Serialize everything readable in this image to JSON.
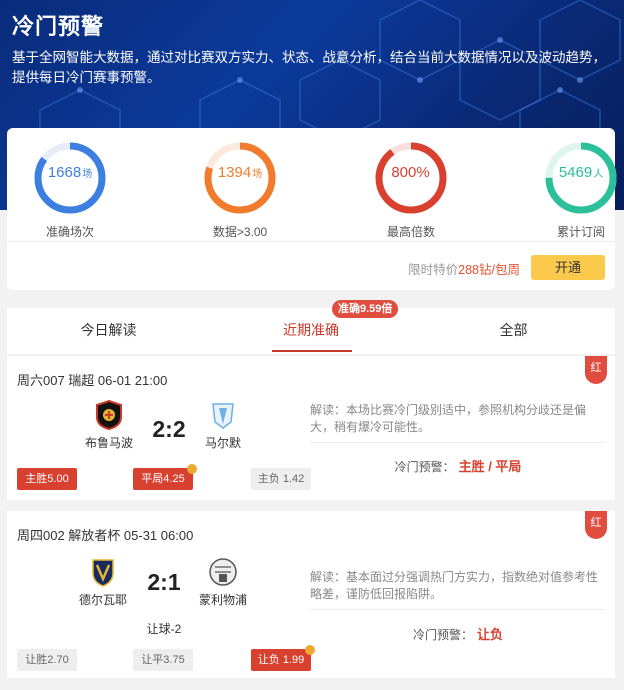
{
  "hero": {
    "title": "冷门预警",
    "description": "基于全网智能大数据，通过对比赛双方实力、状态、战意分析，结合当前大数据情况以及波动趋势，提供每日冷门赛事预警。"
  },
  "stats": [
    {
      "value": "1668",
      "unit": "场",
      "label": "准确场次",
      "color": "#3d7fe0",
      "fill": 0.85
    },
    {
      "value": "1394",
      "unit": "场",
      "label": "数据>3.00",
      "color": "#f07b2d",
      "fill": 0.8
    },
    {
      "value": "800%",
      "unit": "",
      "label": "最高倍数",
      "color": "#d8412f",
      "fill": 0.9
    },
    {
      "value": "5469",
      "unit": "人",
      "label": "累计订阅",
      "color": "#2bbf9a",
      "fill": 0.75
    }
  ],
  "offer": {
    "prefix": "限时特价",
    "price": "288钻/包周",
    "button": "开通"
  },
  "tabs": {
    "items": [
      "今日解读",
      "近期准确",
      "全部"
    ],
    "badge": "准确9.59倍"
  },
  "matches": [
    {
      "header": "周六007 瑞超 06-01 21:00",
      "tag": "红",
      "home": "布鲁马波",
      "away": "马尔默",
      "score": "2:2",
      "handicap": "",
      "odds": [
        {
          "label": "主胜5.00",
          "style": "red",
          "check": false
        },
        {
          "label": "平局4.25",
          "style": "red",
          "check": true
        },
        {
          "label": "主负 1.42",
          "style": "grey",
          "check": false
        }
      ],
      "analysis": "解读：本场比赛冷门级别适中，参照机构分歧还是偏大，稍有爆冷可能性。",
      "warn_label": "冷门预警：",
      "warn_pick": "主胜 / 平局"
    },
    {
      "header": "周四002 解放者杯 05-31 06:00",
      "tag": "红",
      "home": "德尔瓦耶",
      "away": "蒙利物浦",
      "score": "2:1",
      "handicap": "让球-2",
      "odds": [
        {
          "label": "让胜2.70",
          "style": "grey",
          "check": false
        },
        {
          "label": "让平3.75",
          "style": "grey",
          "check": false
        },
        {
          "label": "让负 1.99",
          "style": "red",
          "check": true
        }
      ],
      "analysis": "解读：基本面过分强调热门方实力，指数绝对值参考性略差，谨防低回报陷阱。",
      "warn_label": "冷门预警：",
      "warn_pick": "让负"
    }
  ]
}
